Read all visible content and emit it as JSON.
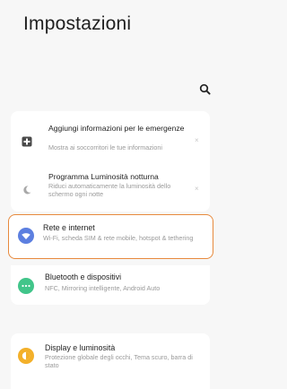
{
  "header": {
    "title": "Impostazioni"
  },
  "icons": {
    "search": "search-icon"
  },
  "suggestions": [
    {
      "icon": "emergency-plus-icon",
      "title": "Aggiungi informazioni per le emergenze",
      "subtitle": "Mostra ai soccorritori le tue informazioni",
      "dismiss": "×"
    },
    {
      "icon": "night-light-moon-icon",
      "title": "Programma Luminosità notturna",
      "subtitle": "Riduci automaticamente la luminosità dello schermo ogni notte",
      "dismiss": "×"
    }
  ],
  "settings": [
    {
      "icon": "wifi-icon",
      "color": "#5c7fe0",
      "title": "Rete e internet",
      "subtitle": "Wi-Fi, scheda SIM & rete mobile, hotspot & tethering",
      "highlight_color": "#e7893c"
    },
    {
      "icon": "connected-devices-icon",
      "color": "#41c58a",
      "title": "Bluetooth e dispositivi",
      "subtitle": "NFC, Mirroring intelligente, Android Auto"
    },
    {
      "icon": "display-brightness-icon",
      "color": "#f3b02a",
      "title": "Display e luminosità",
      "subtitle": "Protezione globale degli occhi, Tema scuro, barra di stato"
    }
  ]
}
